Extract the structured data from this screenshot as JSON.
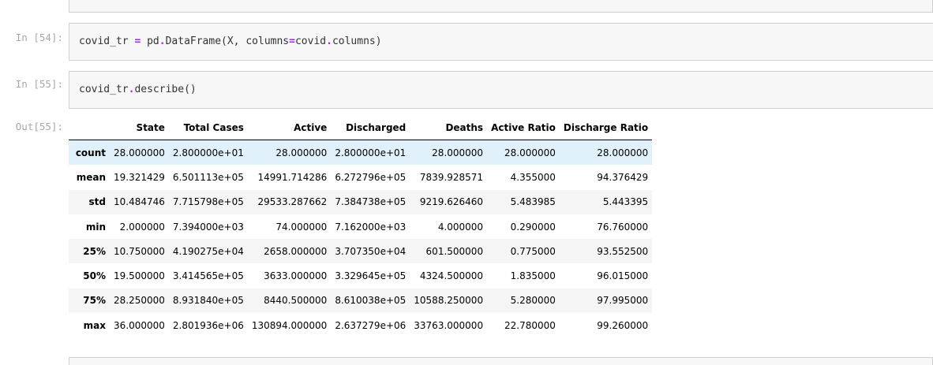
{
  "cells": [
    {
      "prompt": "In [54]:",
      "code": {
        "var": "covid_tr ",
        "eq": "=",
        "mid": " pd",
        "dot": ".",
        "rest": "DataFrame(X, columns",
        "eq2": "=",
        "tail1": "covid",
        "dot2": ".",
        "tail2": "columns)"
      }
    },
    {
      "prompt": "In [55]:",
      "code": {
        "var": "covid_tr",
        "dot": ".",
        "rest": "describe()"
      }
    }
  ],
  "output": {
    "prompt": "Out[55]:",
    "columns": [
      "State",
      "Total Cases",
      "Active",
      "Discharged",
      "Deaths",
      "Active Ratio",
      "Discharge Ratio"
    ],
    "rows": [
      {
        "label": "count",
        "values": [
          "28.000000",
          "2.800000e+01",
          "28.000000",
          "2.800000e+01",
          "28.000000",
          "28.000000",
          "28.000000"
        ]
      },
      {
        "label": "mean",
        "values": [
          "19.321429",
          "6.501113e+05",
          "14991.714286",
          "6.272796e+05",
          "7839.928571",
          "4.355000",
          "94.376429"
        ]
      },
      {
        "label": "std",
        "values": [
          "10.484746",
          "7.715798e+05",
          "29533.287662",
          "7.384738e+05",
          "9219.626460",
          "5.483985",
          "5.443395"
        ]
      },
      {
        "label": "min",
        "values": [
          "2.000000",
          "7.394000e+03",
          "74.000000",
          "7.162000e+03",
          "4.000000",
          "0.290000",
          "76.760000"
        ]
      },
      {
        "label": "25%",
        "values": [
          "10.750000",
          "4.190275e+04",
          "2658.000000",
          "3.707350e+04",
          "601.500000",
          "0.775000",
          "93.552500"
        ]
      },
      {
        "label": "50%",
        "values": [
          "19.500000",
          "3.414565e+05",
          "3633.000000",
          "3.329645e+05",
          "4324.500000",
          "1.835000",
          "96.015000"
        ]
      },
      {
        "label": "75%",
        "values": [
          "28.250000",
          "8.931840e+05",
          "8440.500000",
          "8.610038e+05",
          "10588.250000",
          "5.280000",
          "97.995000"
        ]
      },
      {
        "label": "max",
        "values": [
          "36.000000",
          "2.801936e+06",
          "130894.000000",
          "2.637279e+06",
          "33763.000000",
          "22.780000",
          "99.260000"
        ]
      }
    ]
  }
}
